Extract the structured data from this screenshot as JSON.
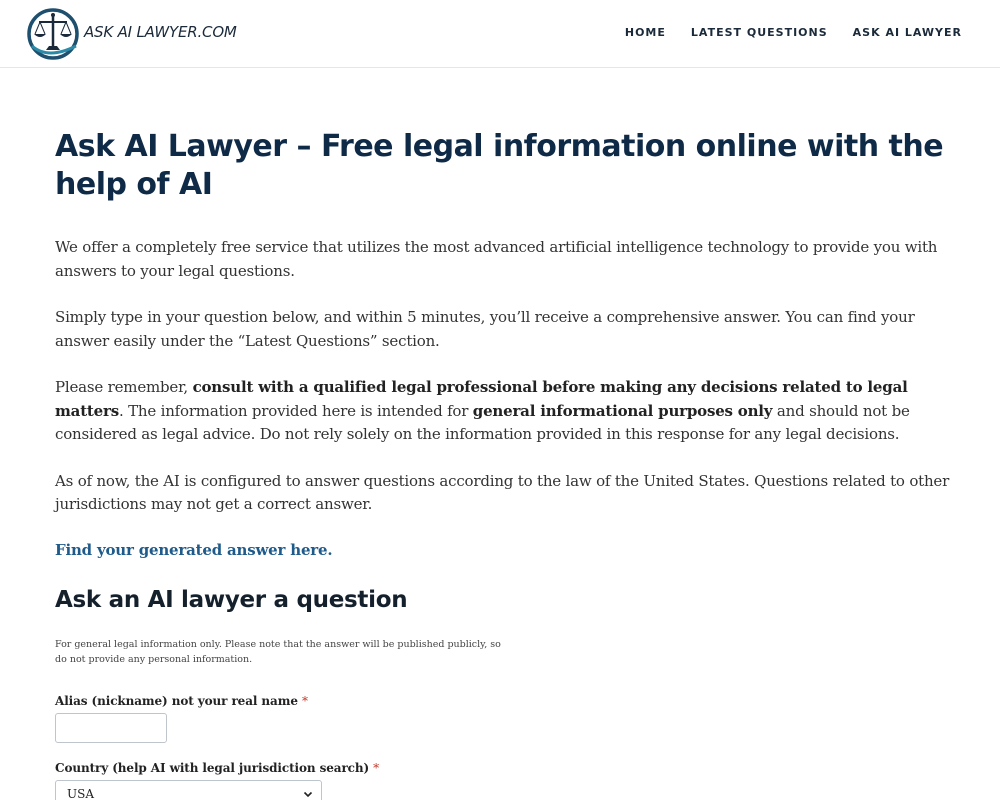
{
  "header": {
    "site_name": "ASK AI LAWYER.COM",
    "nav": [
      {
        "label": "HOME"
      },
      {
        "label": "LATEST QUESTIONS"
      },
      {
        "label": "ASK AI LAWYER"
      }
    ]
  },
  "main": {
    "title": "Ask AI Lawyer – Free legal information online with the help of AI",
    "p1": "We offer a completely free service that utilizes the most advanced artificial intelligence technology to provide you with answers to your legal questions.",
    "p2": "Simply type in your question below, and within 5 minutes, you’ll receive a comprehensive answer. You can find your answer easily under the “Latest Questions” section.",
    "p3": {
      "a": "Please remember, ",
      "b": "consult with a qualified legal professional before making any decisions related to legal matters",
      "c": ". The information provided here is intended for ",
      "d": "general informational purposes only",
      "e": " and should not be considered as legal advice. Do not rely solely on the information provided in this response for any legal decisions."
    },
    "p4": "As of now, the AI is configured to answer questions according to the law of the United States. Questions related to other jurisdictions may not get a correct answer.",
    "answer_link": "Find your generated answer here."
  },
  "form": {
    "title": "Ask an AI lawyer a question",
    "note": "For general legal information only. Please note that the answer will be published publicly, so do not provide any personal information.",
    "alias_label": "Alias (nickname) not your real name",
    "alias_value": "",
    "country_label": "Country (help AI with legal jurisdiction search)",
    "country_value": "USA",
    "required_mark": "*"
  },
  "colors": {
    "title": "#0f2a47",
    "link": "#1e5a8a",
    "required": "#c0392b"
  }
}
